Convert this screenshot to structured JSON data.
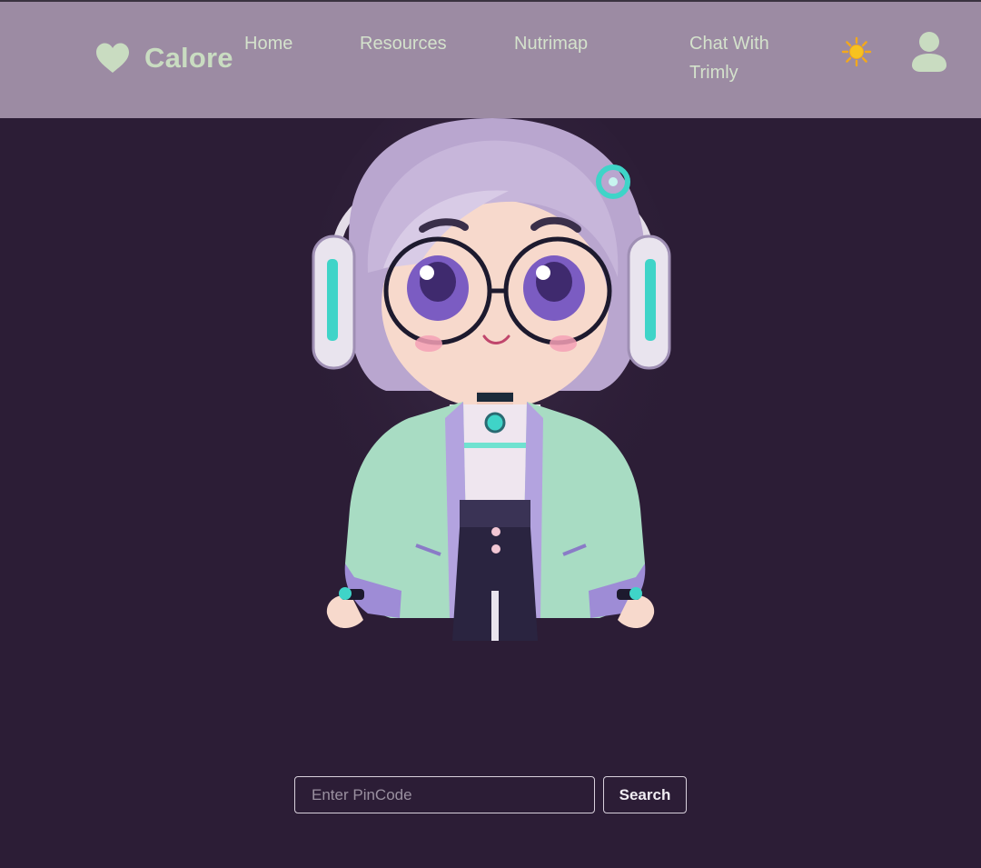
{
  "brand": {
    "name": "Calore",
    "icon": "heart-icon",
    "color": "#c9dcc1"
  },
  "nav": {
    "links": [
      {
        "label": "Home"
      },
      {
        "label": "Resources"
      },
      {
        "label": "Nutrimap"
      },
      {
        "label": "Chat With Trimly"
      }
    ],
    "theme_icon": "sun-icon",
    "profile_icon": "user-avatar-icon"
  },
  "hero": {
    "image": "chibi-character-illustration"
  },
  "search": {
    "placeholder": "Enter PinCode",
    "value": "",
    "button_label": "Search"
  },
  "colors": {
    "navbar": "#9c8ba3",
    "background": "#2c1d36",
    "accent_text": "#d4e2cc"
  }
}
